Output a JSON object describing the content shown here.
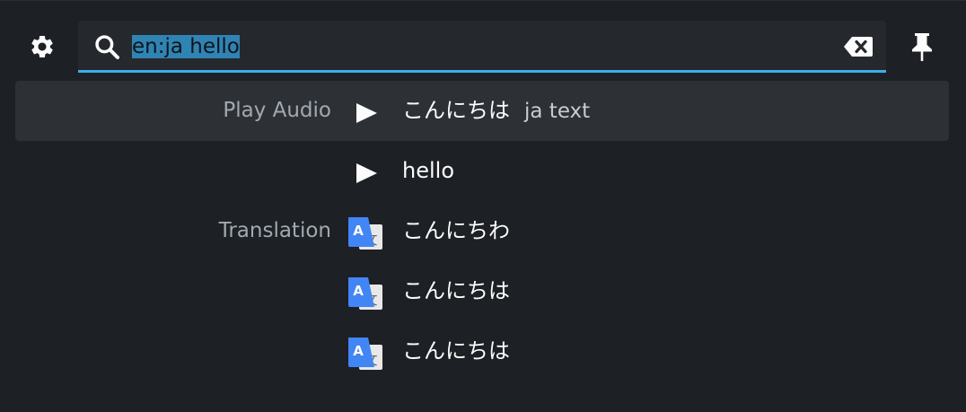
{
  "toolbar": {
    "settings_icon": "gear-icon",
    "pin_icon": "pin-icon"
  },
  "search": {
    "query": "en:ja hello",
    "search_icon": "search-icon",
    "clear_icon": "backspace-clear-icon",
    "accent_color": "#3daee9"
  },
  "results": [
    {
      "category": "Play Audio",
      "icon": "play-icon",
      "text": "こんにちは",
      "subtext": "ja text",
      "highlighted": true
    },
    {
      "category": "",
      "icon": "play-icon",
      "text": "hello",
      "subtext": ""
    },
    {
      "category": "Translation",
      "icon": "google-translate-icon",
      "text": "こんにちわ",
      "subtext": ""
    },
    {
      "category": "",
      "icon": "google-translate-icon",
      "text": "こんにちは",
      "subtext": ""
    },
    {
      "category": "",
      "icon": "google-translate-icon",
      "text": "こんにちは",
      "subtext": ""
    }
  ]
}
